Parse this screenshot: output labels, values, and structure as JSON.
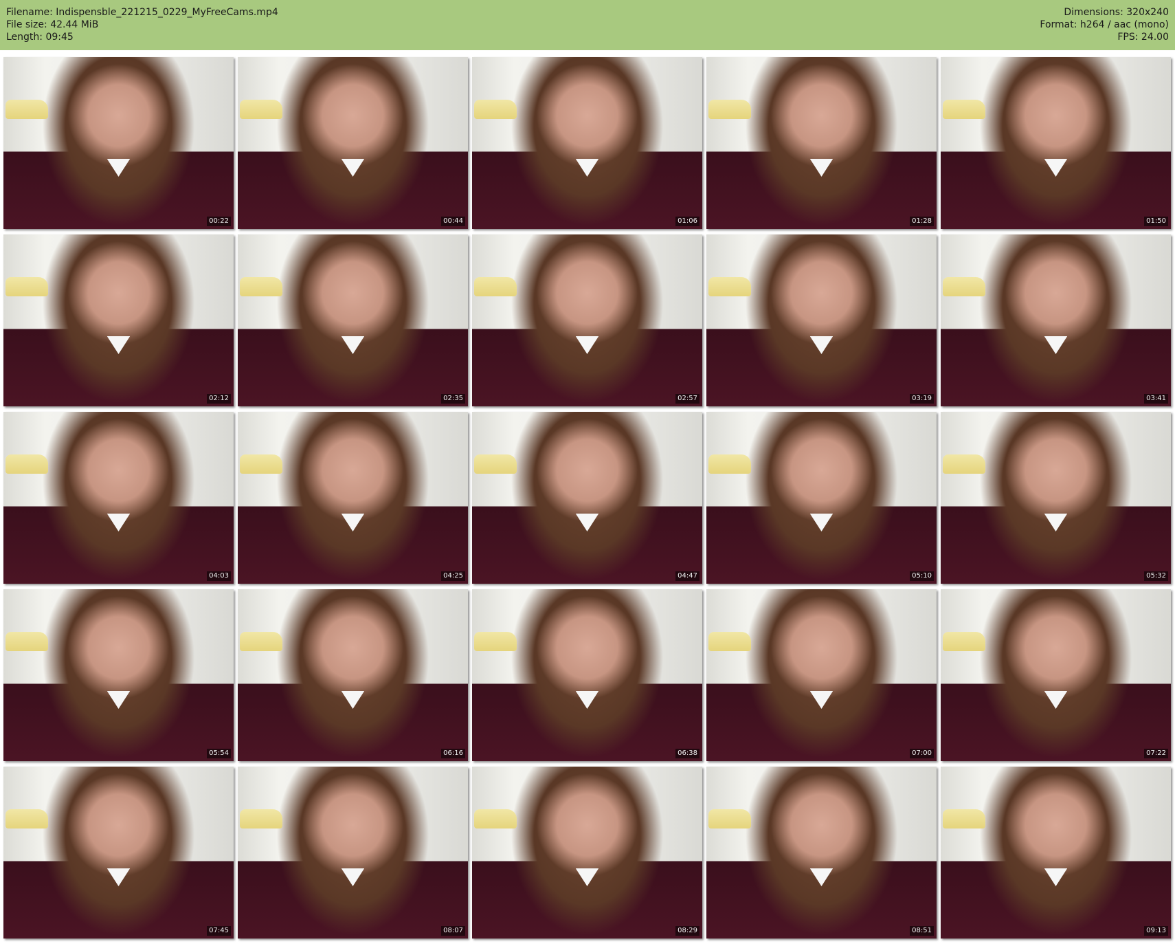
{
  "header": {
    "filename": "Filename: Indispensble_221215_0229_MyFreeCams.mp4",
    "filesize": "File size: 42.44 MiB",
    "length": "Length: 09:45",
    "dimensions": "Dimensions: 320x240",
    "format": "Format: h264 / aac (mono)",
    "fps": "FPS: 24.00"
  },
  "thumbnails": [
    {
      "time": "00:22"
    },
    {
      "time": "00:44"
    },
    {
      "time": "01:06"
    },
    {
      "time": "01:28"
    },
    {
      "time": "01:50"
    },
    {
      "time": "02:12"
    },
    {
      "time": "02:35"
    },
    {
      "time": "02:57"
    },
    {
      "time": "03:19"
    },
    {
      "time": "03:41"
    },
    {
      "time": "04:03"
    },
    {
      "time": "04:25"
    },
    {
      "time": "04:47"
    },
    {
      "time": "05:10"
    },
    {
      "time": "05:32"
    },
    {
      "time": "05:54"
    },
    {
      "time": "06:16"
    },
    {
      "time": "06:38"
    },
    {
      "time": "07:00"
    },
    {
      "time": "07:22"
    },
    {
      "time": "07:45"
    },
    {
      "time": "08:07"
    },
    {
      "time": "08:29"
    },
    {
      "time": "08:51"
    },
    {
      "time": "09:13"
    }
  ]
}
